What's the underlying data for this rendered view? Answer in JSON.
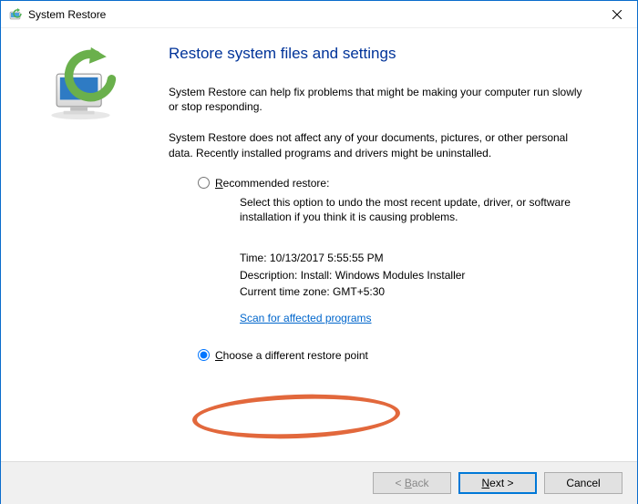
{
  "window": {
    "title": "System Restore"
  },
  "heading": "Restore system files and settings",
  "intro1": "System Restore can help fix problems that might be making your computer run slowly or stop responding.",
  "intro2": "System Restore does not affect any of your documents, pictures, or other personal data. Recently installed programs and drivers might be uninstalled.",
  "options": {
    "recommended": {
      "label": "Recommended restore:",
      "desc": "Select this option to undo the most recent update, driver, or software installation if you think it is causing problems.",
      "time": "Time: 10/13/2017 5:55:55 PM",
      "description_line": "Description: Install: Windows Modules Installer",
      "timezone": "Current time zone: GMT+5:30",
      "scan_link": "Scan for affected programs"
    },
    "different": {
      "label": "Choose a different restore point"
    }
  },
  "buttons": {
    "back": "< Back",
    "next": "Next >",
    "cancel": "Cancel"
  }
}
